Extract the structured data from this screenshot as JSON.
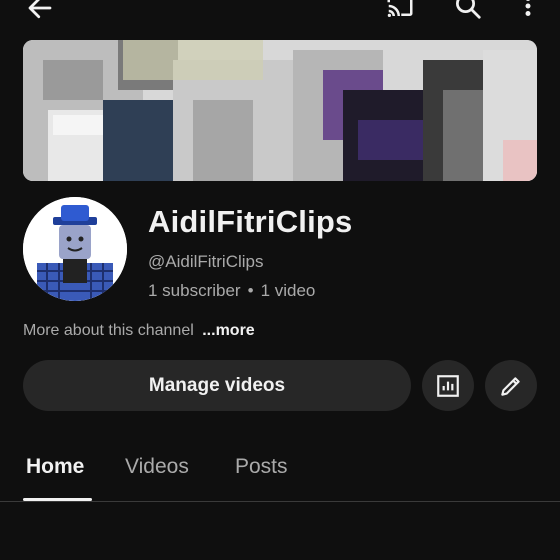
{
  "topbar": {
    "back_icon": "arrow-left-icon",
    "cast_icon": "cast-icon",
    "search_icon": "search-icon",
    "more_icon": "more-vertical-icon"
  },
  "banner": {
    "alt": "channel-banner"
  },
  "channel": {
    "name": "AidilFitriClips",
    "handle": "@AidilFitriClips",
    "subscribers": "1 subscriber",
    "separator": "•",
    "videos": "1 video",
    "about_text": "More about this channel",
    "more_link": "...more"
  },
  "actions": {
    "manage_videos": "Manage videos",
    "analytics_icon": "analytics-icon",
    "edit_icon": "pencil-icon"
  },
  "tabs": [
    {
      "label": "Home",
      "active": true
    },
    {
      "label": "Videos",
      "active": false
    },
    {
      "label": "Posts",
      "active": false
    }
  ],
  "colors": {
    "background": "#0f0f0f",
    "text": "#f1f1f1",
    "secondary_text": "#aaaaaa",
    "button_bg": "#272727"
  }
}
